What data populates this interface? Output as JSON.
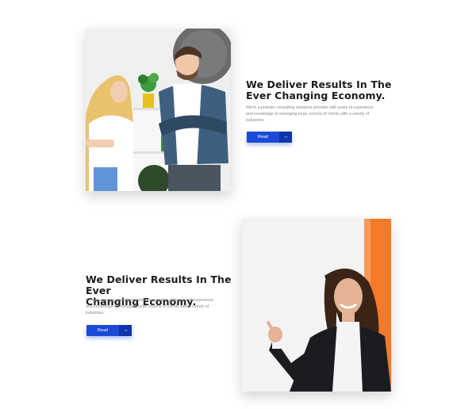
{
  "feature_top": {
    "heading_line1": "We Deliver Results In The",
    "heading_line2": "Ever Changing Economy.",
    "body_line1": "We're a premier consulting solutions provider with years of experience",
    "body_line2": "and knowledge in managing large volume of clients with a variety of",
    "body_line3": "industries.",
    "button_label": "Read More",
    "button_icon": "arrow-right-icon",
    "button_icon_glyph": "→"
  },
  "feature_bottom": {
    "heading_line1": "We Deliver Results In The Ever",
    "heading_line2": "Changing Economy.",
    "body_line1": "We're a premier consulting solutions provider with years of experience",
    "body_line2": "and knowledge in managing large volume of clients with a variety of",
    "body_line3": "industries.",
    "button_label": "Read More",
    "button_icon": "arrow-right-icon",
    "button_icon_glyph": "→"
  },
  "colors": {
    "accent": "#1a4ad6",
    "accent_dark": "#0f35a8",
    "heading": "#1c1c1c",
    "body_text": "#8a8a8a",
    "orange_panel": "#f47a2a"
  }
}
